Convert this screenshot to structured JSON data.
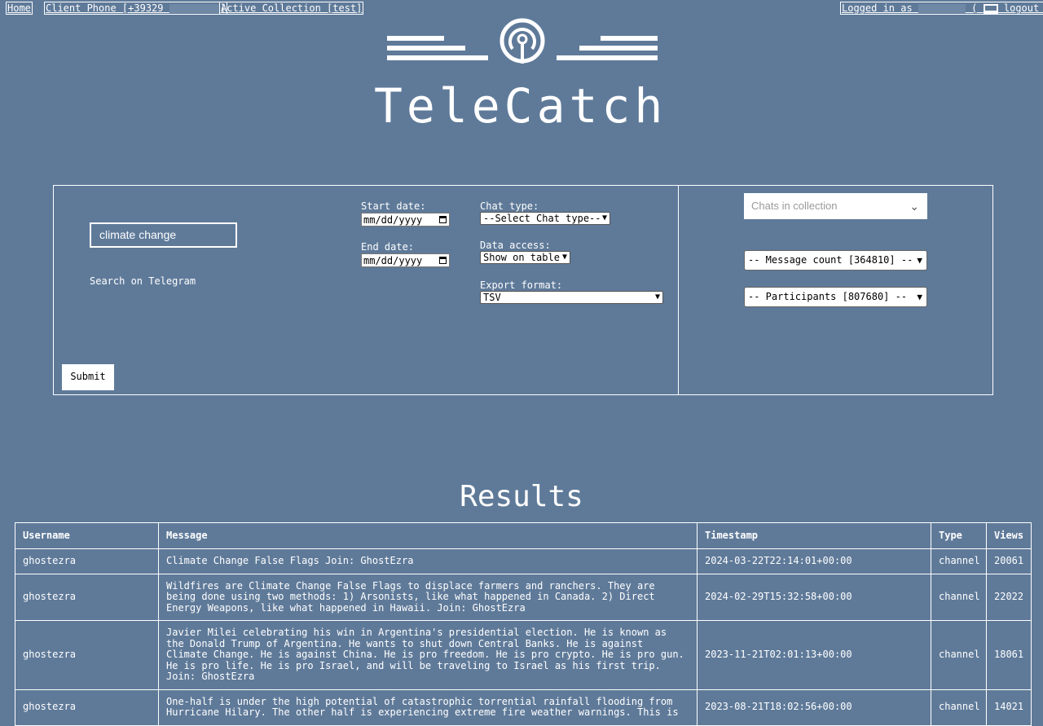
{
  "nav": {
    "home": "Home",
    "client_phone": "Client Phone [+39329",
    "client_phone_end": "]",
    "active_collection": "Active Collection [test]",
    "logged_in": "Logged in as",
    "logout": "logout )",
    "paren_open": "("
  },
  "brand": {
    "name": "TeleCatch",
    "logo_icon": "broadcast-antenna-icon"
  },
  "search": {
    "query": "climate change",
    "label": "Search on Telegram",
    "submit": "Submit"
  },
  "filters": {
    "start_date_label": "Start date:",
    "end_date_label": "End date:",
    "date_placeholder": "mm/dd/yyyy",
    "chat_type_label": "Chat type:",
    "chat_type_value": "--Select Chat type--",
    "data_access_label": "Data access:",
    "data_access_value": "Show on table",
    "export_label": "Export format:",
    "export_value": "TSV"
  },
  "collection": {
    "chats_placeholder": "Chats in collection",
    "message_count": "-- Message count [364810] --",
    "participants": "-- Participants [807680] --"
  },
  "results": {
    "title": "Results",
    "columns": [
      "Username",
      "Message",
      "Timestamp",
      "Type",
      "Views"
    ],
    "rows": [
      {
        "username": "ghostezra",
        "message": "Climate Change False Flags Join: GhostEzra",
        "timestamp": "2024-03-22T22:14:01+00:00",
        "type": "channel",
        "views": "20061"
      },
      {
        "username": "ghostezra",
        "message": "Wildfires are Climate Change False Flags to displace farmers and ranchers. They are being done using two methods: 1) Arsonists, like what happened in Canada. 2) Direct Energy Weapons, like what happened in Hawaii. Join: GhostEzra",
        "timestamp": "2024-02-29T15:32:58+00:00",
        "type": "channel",
        "views": "22022"
      },
      {
        "username": "ghostezra",
        "message": "Javier Milei celebrating his win in Argentina's presidential election. He is known as the Donald Trump of Argentina. He wants to shut down Central Banks. He is against Climate Change. He is against China. He is pro freedom. He is pro crypto. He is pro gun. He is pro life. He is pro Israel, and will be traveling to Israel as his first trip. Join: GhostEzra",
        "timestamp": "2023-11-21T02:01:13+00:00",
        "type": "channel",
        "views": "18061"
      },
      {
        "username": "ghostezra",
        "message": "One-half is under the high potential of catastrophic torrential rainfall flooding from Hurricane Hilary. The other half is experiencing extreme fire weather warnings. This is",
        "timestamp": "2023-08-21T18:02:56+00:00",
        "type": "channel",
        "views": "14021"
      }
    ]
  }
}
